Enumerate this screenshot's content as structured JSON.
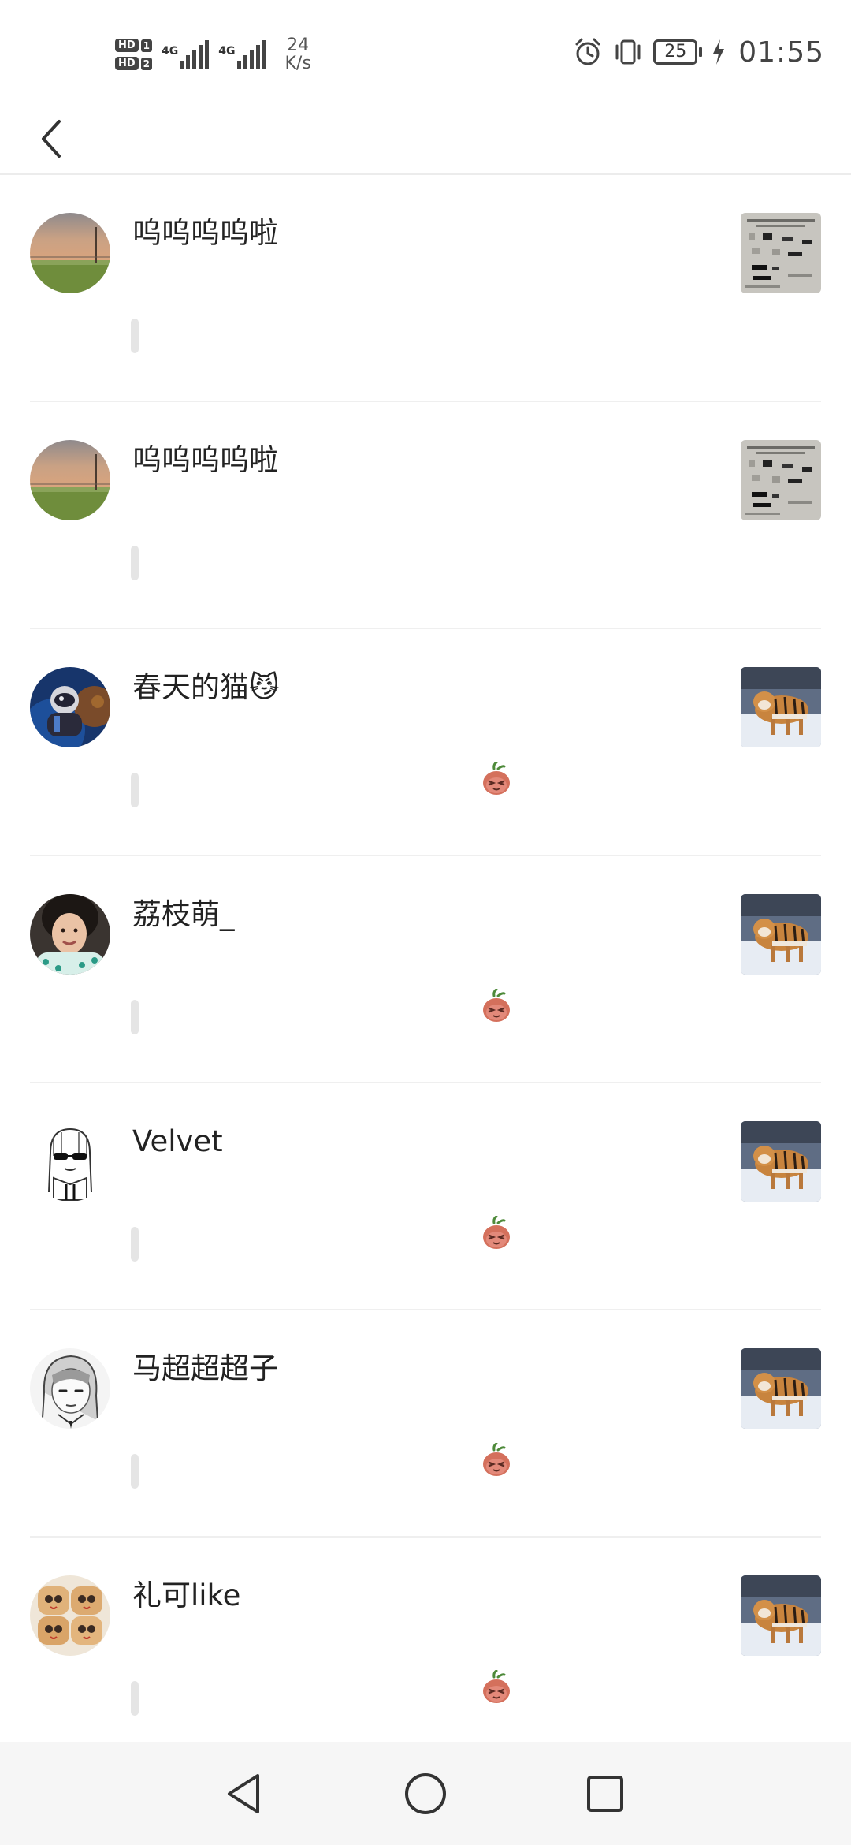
{
  "status_bar": {
    "sim1": "HD",
    "sim1_num": "1",
    "sim2": "HD",
    "sim2_num": "2",
    "net1": "4G",
    "net2": "4G",
    "speed_value": "24",
    "speed_unit": "K/s",
    "battery": "25",
    "time": "01:55",
    "icons": [
      "alarm-icon",
      "vibrate-icon",
      "battery-icon",
      "charging-icon"
    ]
  },
  "app_bar": {
    "back_icon": "chevron-left-icon"
  },
  "items": [
    {
      "name": "呜呜呜呜啦",
      "avatar": "sunset-field",
      "thumbnail": "document",
      "reaction": false
    },
    {
      "name": "呜呜呜呜啦",
      "avatar": "sunset-field",
      "thumbnail": "document",
      "reaction": false
    },
    {
      "name": "春天的猫😼",
      "avatar": "diver",
      "thumbnail": "tiger",
      "reaction": true
    },
    {
      "name": "荔枝萌_",
      "avatar": "girl-photo",
      "thumbnail": "tiger",
      "reaction": true
    },
    {
      "name": "Velvet",
      "avatar": "sketch-sunglasses",
      "thumbnail": "tiger",
      "reaction": true
    },
    {
      "name": "马超超超子",
      "avatar": "sketch-girl",
      "thumbnail": "tiger",
      "reaction": true
    },
    {
      "name": "礼可like",
      "avatar": "bread-buns",
      "thumbnail": "tiger",
      "reaction": true
    }
  ],
  "nav_bar": {
    "back": "triangle-back-icon",
    "home": "circle-home-icon",
    "recents": "square-recents-icon"
  },
  "colors": {
    "background": "#ffffff",
    "divider": "#efefef",
    "nav_background": "#f6f6f6",
    "text": "#222222"
  }
}
